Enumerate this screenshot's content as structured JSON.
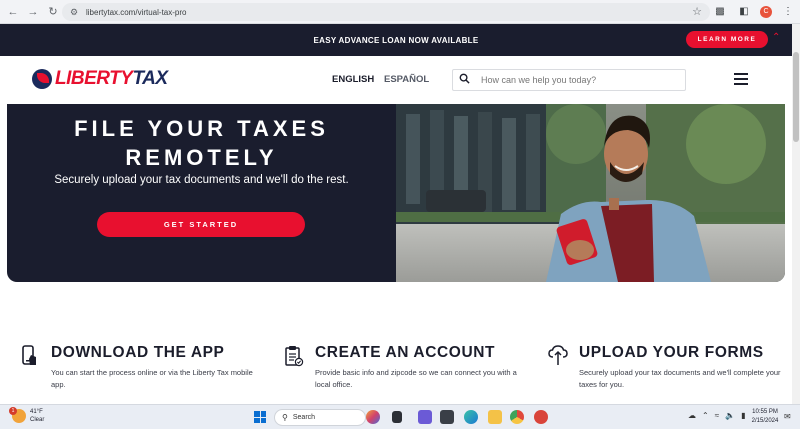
{
  "browser": {
    "url": "libertytax.com/virtual-tax-pro",
    "profile_initial": "C"
  },
  "promo": {
    "text": "EASY ADVANCE LOAN NOW AVAILABLE",
    "button": "LEARN MORE"
  },
  "header": {
    "logo_part1": "LIBERTY",
    "logo_part2": "TAX",
    "lang_en": "ENGLISH",
    "lang_es": "ESPAÑOL",
    "search_placeholder": "How can we help you today?"
  },
  "hero": {
    "title_line1": "FILE YOUR TAXES",
    "title_line2": "REMOTELY",
    "subtitle": "Securely upload your tax documents and we'll do the rest.",
    "cta": "GET STARTED"
  },
  "features": [
    {
      "title": "DOWNLOAD THE APP",
      "desc": "You can start the process online or via the Liberty Tax mobile app."
    },
    {
      "title": "CREATE AN ACCOUNT",
      "desc": "Provide basic info and zipcode so we can connect you with a local office."
    },
    {
      "title": "UPLOAD YOUR FORMS",
      "desc": "Securely upload your tax documents and we'll complete your taxes for you."
    }
  ],
  "taskbar": {
    "weather_temp": "41°F",
    "weather_cond": "Clear",
    "weather_badge": "1",
    "search_label": "Search",
    "time": "10:55 PM",
    "date": "2/15/2024"
  },
  "colors": {
    "brand_red": "#e8102f",
    "brand_navy": "#1a1d2e"
  }
}
